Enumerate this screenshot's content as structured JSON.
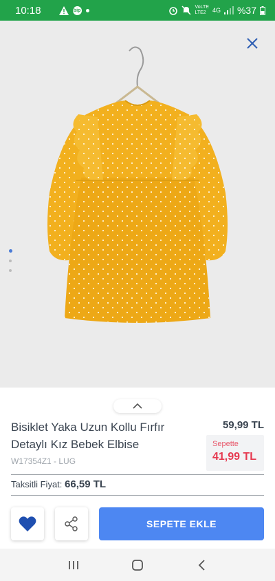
{
  "status_bar": {
    "time": "10:18",
    "notification_icons": [
      "warning-icon",
      "bip-icon",
      "dot-icon"
    ],
    "bip_label": "bip",
    "network_label_top": "VoLTE",
    "network_label_mid": "LTE2",
    "network_type": "4G",
    "battery_text": "%37"
  },
  "product": {
    "title": "Bisiklet Yaka Uzun Kollu Fırfır Detaylı Kız Bebek Elbise",
    "sku": "W17354Z1 - LUG",
    "price": "59,99 TL",
    "cart_label": "Sepette",
    "cart_price": "41,99 TL",
    "installment_label": "Taksitli Fiyat:",
    "installment_price": "66,59 TL",
    "image_color": "#f2b01e"
  },
  "gallery": {
    "pages": 3,
    "active_page": 1
  },
  "actions": {
    "add_to_cart_label": "SEPETE EKLE",
    "favorite_icon": "heart-icon",
    "share_icon": "share-icon"
  },
  "colors": {
    "status_bar": "#22a34a",
    "accent_blue": "#4d87f2",
    "heart": "#1f4fb0",
    "cart_price_red": "#e63950"
  },
  "nav": {
    "items": [
      "recent-apps-icon",
      "home-icon",
      "back-icon"
    ]
  }
}
